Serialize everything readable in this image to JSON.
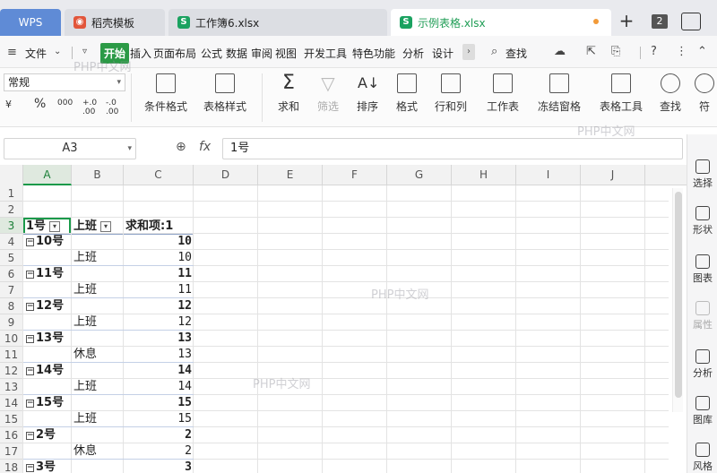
{
  "tabs": {
    "wps": "WPS",
    "daoke": "稻壳模板",
    "book6": "工作簿6.xlsx",
    "sample": "示例表格.xlsx",
    "add": "+",
    "window_count": "2"
  },
  "menu": {
    "file": "文件",
    "items": [
      "开始",
      "插入",
      "页面布局",
      "公式",
      "数据",
      "审阅",
      "视图",
      "开发工具",
      "特色功能",
      "分析",
      "设计"
    ],
    "search": "查找"
  },
  "ribbon": {
    "number_format": "常规",
    "numfmt_symbols": [
      "¥",
      "%",
      "000",
      "+.0 .00",
      "-.0 .00"
    ],
    "buttons": [
      {
        "label": "条件格式",
        "icon": "conditional-format-icon",
        "enabled": true
      },
      {
        "label": "表格样式",
        "icon": "table-style-icon",
        "enabled": true
      },
      {
        "label": "求和",
        "icon": "sum-icon",
        "enabled": true
      },
      {
        "label": "筛选",
        "icon": "filter-icon",
        "enabled": false
      },
      {
        "label": "排序",
        "icon": "sort-icon",
        "enabled": true
      },
      {
        "label": "格式",
        "icon": "format-icon",
        "enabled": true
      },
      {
        "label": "行和列",
        "icon": "row-col-icon",
        "enabled": true
      },
      {
        "label": "工作表",
        "icon": "worksheet-icon",
        "enabled": true
      },
      {
        "label": "冻结窗格",
        "icon": "freeze-icon",
        "enabled": true
      },
      {
        "label": "表格工具",
        "icon": "table-tools-icon",
        "enabled": true
      },
      {
        "label": "查找",
        "icon": "find-icon",
        "enabled": true
      },
      {
        "label": "符",
        "icon": "symbol-icon",
        "enabled": true
      }
    ]
  },
  "formula": {
    "name_box": "A3",
    "fx": "fx",
    "value": "1号"
  },
  "grid": {
    "columns": [
      "A",
      "B",
      "C",
      "D",
      "E",
      "F",
      "G",
      "H",
      "I",
      "J"
    ],
    "active_column": "A",
    "rows": [
      "1",
      "2",
      "3",
      "4",
      "5",
      "6",
      "7",
      "8",
      "9",
      "10",
      "11",
      "12",
      "13",
      "14",
      "15",
      "16",
      "17",
      "18"
    ],
    "active_row": "3",
    "header": {
      "a": "1号",
      "b": "上班",
      "c": "求和项:1"
    },
    "data": [
      {
        "row": 4,
        "a": "10号",
        "b": "",
        "c": "10",
        "group": true
      },
      {
        "row": 5,
        "a": "",
        "b": "上班",
        "c": "10",
        "group": false
      },
      {
        "row": 6,
        "a": "11号",
        "b": "",
        "c": "11",
        "group": true
      },
      {
        "row": 7,
        "a": "",
        "b": "上班",
        "c": "11",
        "group": false
      },
      {
        "row": 8,
        "a": "12号",
        "b": "",
        "c": "12",
        "group": true
      },
      {
        "row": 9,
        "a": "",
        "b": "上班",
        "c": "12",
        "group": false
      },
      {
        "row": 10,
        "a": "13号",
        "b": "",
        "c": "13",
        "group": true
      },
      {
        "row": 11,
        "a": "",
        "b": "休息",
        "c": "13",
        "group": false
      },
      {
        "row": 12,
        "a": "14号",
        "b": "",
        "c": "14",
        "group": true
      },
      {
        "row": 13,
        "a": "",
        "b": "上班",
        "c": "14",
        "group": false
      },
      {
        "row": 14,
        "a": "15号",
        "b": "",
        "c": "15",
        "group": true
      },
      {
        "row": 15,
        "a": "",
        "b": "上班",
        "c": "15",
        "group": false
      },
      {
        "row": 16,
        "a": "2号",
        "b": "",
        "c": "2",
        "group": true
      },
      {
        "row": 17,
        "a": "",
        "b": "休息",
        "c": "2",
        "group": false
      },
      {
        "row": 18,
        "a": "3号",
        "b": "",
        "c": "3",
        "group": true
      }
    ],
    "watermark": "PHP中文网"
  },
  "side_panel": [
    {
      "label": "选择",
      "icon": "select-icon",
      "enabled": true
    },
    {
      "label": "形状",
      "icon": "shape-icon",
      "enabled": true
    },
    {
      "label": "图表",
      "icon": "chart-icon",
      "enabled": true
    },
    {
      "label": "属性",
      "icon": "property-icon",
      "enabled": false
    },
    {
      "label": "分析",
      "icon": "analysis-icon",
      "enabled": true
    },
    {
      "label": "图库",
      "icon": "gallery-icon",
      "enabled": true
    },
    {
      "label": "风格",
      "icon": "style-icon",
      "enabled": true
    }
  ]
}
